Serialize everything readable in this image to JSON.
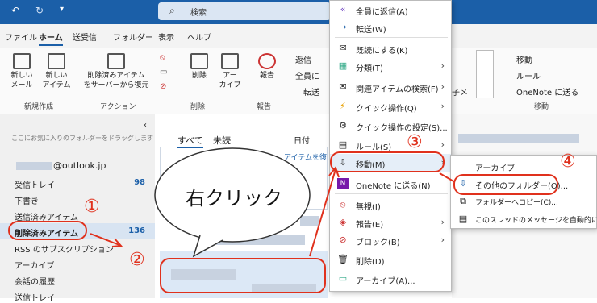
{
  "search_placeholder": "検索",
  "ribbon_tabs": [
    "ファイル",
    "ホーム",
    "送受信",
    "フォルダー",
    "表示",
    "ヘルプ"
  ],
  "ribbon": {
    "new_mail": "新しい\nメール",
    "new_item": "新しい\nアイテム",
    "restore": "削除済みアイテム\nをサーバーから復元",
    "delete": "削除",
    "archive": "アー\nカイブ",
    "report": "報告",
    "reply": "返信",
    "reply_all": "全員に",
    "forward": "転送",
    "move": "移動",
    "rules": "ルール",
    "onenote": "OneNote に送る",
    "groups": [
      "新規作成",
      "アクション",
      "削除",
      "報告",
      "移動"
    ]
  },
  "folders": {
    "hint": "ここにお気に入りのフォルダーをドラッグします",
    "account": "@outlook.jp",
    "items": [
      {
        "label": "受信トレイ",
        "count": "98"
      },
      {
        "label": "下書き",
        "count": ""
      },
      {
        "label": "送信済みアイテム",
        "count": ""
      },
      {
        "label": "削除済みアイテム",
        "count": "136"
      },
      {
        "label": "RSS のサブスクリプション",
        "count": ""
      },
      {
        "label": "アーカイブ",
        "count": ""
      },
      {
        "label": "会話の履歴",
        "count": ""
      },
      {
        "label": "送信トレイ",
        "count": ""
      }
    ]
  },
  "msglist": {
    "tab_all": "すべて",
    "tab_unread": "未読",
    "sort": "日付",
    "preview_snip": "アイテムを復"
  },
  "context_menu": [
    {
      "label": "全員に返信(A)",
      "icon": "reply-all-icon",
      "arrow": false
    },
    {
      "label": "転送(W)",
      "icon": "forward-icon",
      "arrow": false
    },
    {
      "label": "既読にする(K)",
      "icon": "envelope-open-icon",
      "arrow": false
    },
    {
      "label": "分類(T)",
      "icon": "category-icon",
      "arrow": true
    },
    {
      "label": "関連アイテムの検索(F)",
      "icon": "envelope-search-icon",
      "arrow": true
    },
    {
      "label": "クイック操作(Q)",
      "icon": "lightning-icon",
      "arrow": true
    },
    {
      "label": "クイック操作の設定(S)...",
      "icon": "gear-icon",
      "arrow": false
    },
    {
      "label": "ルール(S)",
      "icon": "rules-icon",
      "arrow": true
    },
    {
      "label": "移動(M)",
      "icon": "move-icon",
      "arrow": true
    },
    {
      "label": "OneNote に送る(N)",
      "icon": "onenote-icon",
      "arrow": false
    },
    {
      "label": "無視(I)",
      "icon": "ignore-icon",
      "arrow": false
    },
    {
      "label": "報告(E)",
      "icon": "report-icon",
      "arrow": true
    },
    {
      "label": "ブロック(B)",
      "icon": "block-icon",
      "arrow": true
    },
    {
      "label": "削除(D)",
      "icon": "trash-icon",
      "arrow": false
    },
    {
      "label": "アーカイブ(A)...",
      "icon": "archive-icon",
      "arrow": false
    }
  ],
  "submenu": [
    {
      "label": "アーカイブ"
    },
    {
      "label": "その他のフォルダー(O)..."
    },
    {
      "label": "フォルダーへコピー(C)..."
    },
    {
      "label": "このスレッドのメッセージを自動的に移動"
    }
  ],
  "annotations": {
    "bubble": "右クリック",
    "n1": "①",
    "n2": "②",
    "n3": "③",
    "n4": "④"
  },
  "preview_fragment": "子メ",
  "colors": {
    "titlebar": "#1b5fa8",
    "annotation": "#e0311d",
    "accent": "#1b5fa8"
  }
}
